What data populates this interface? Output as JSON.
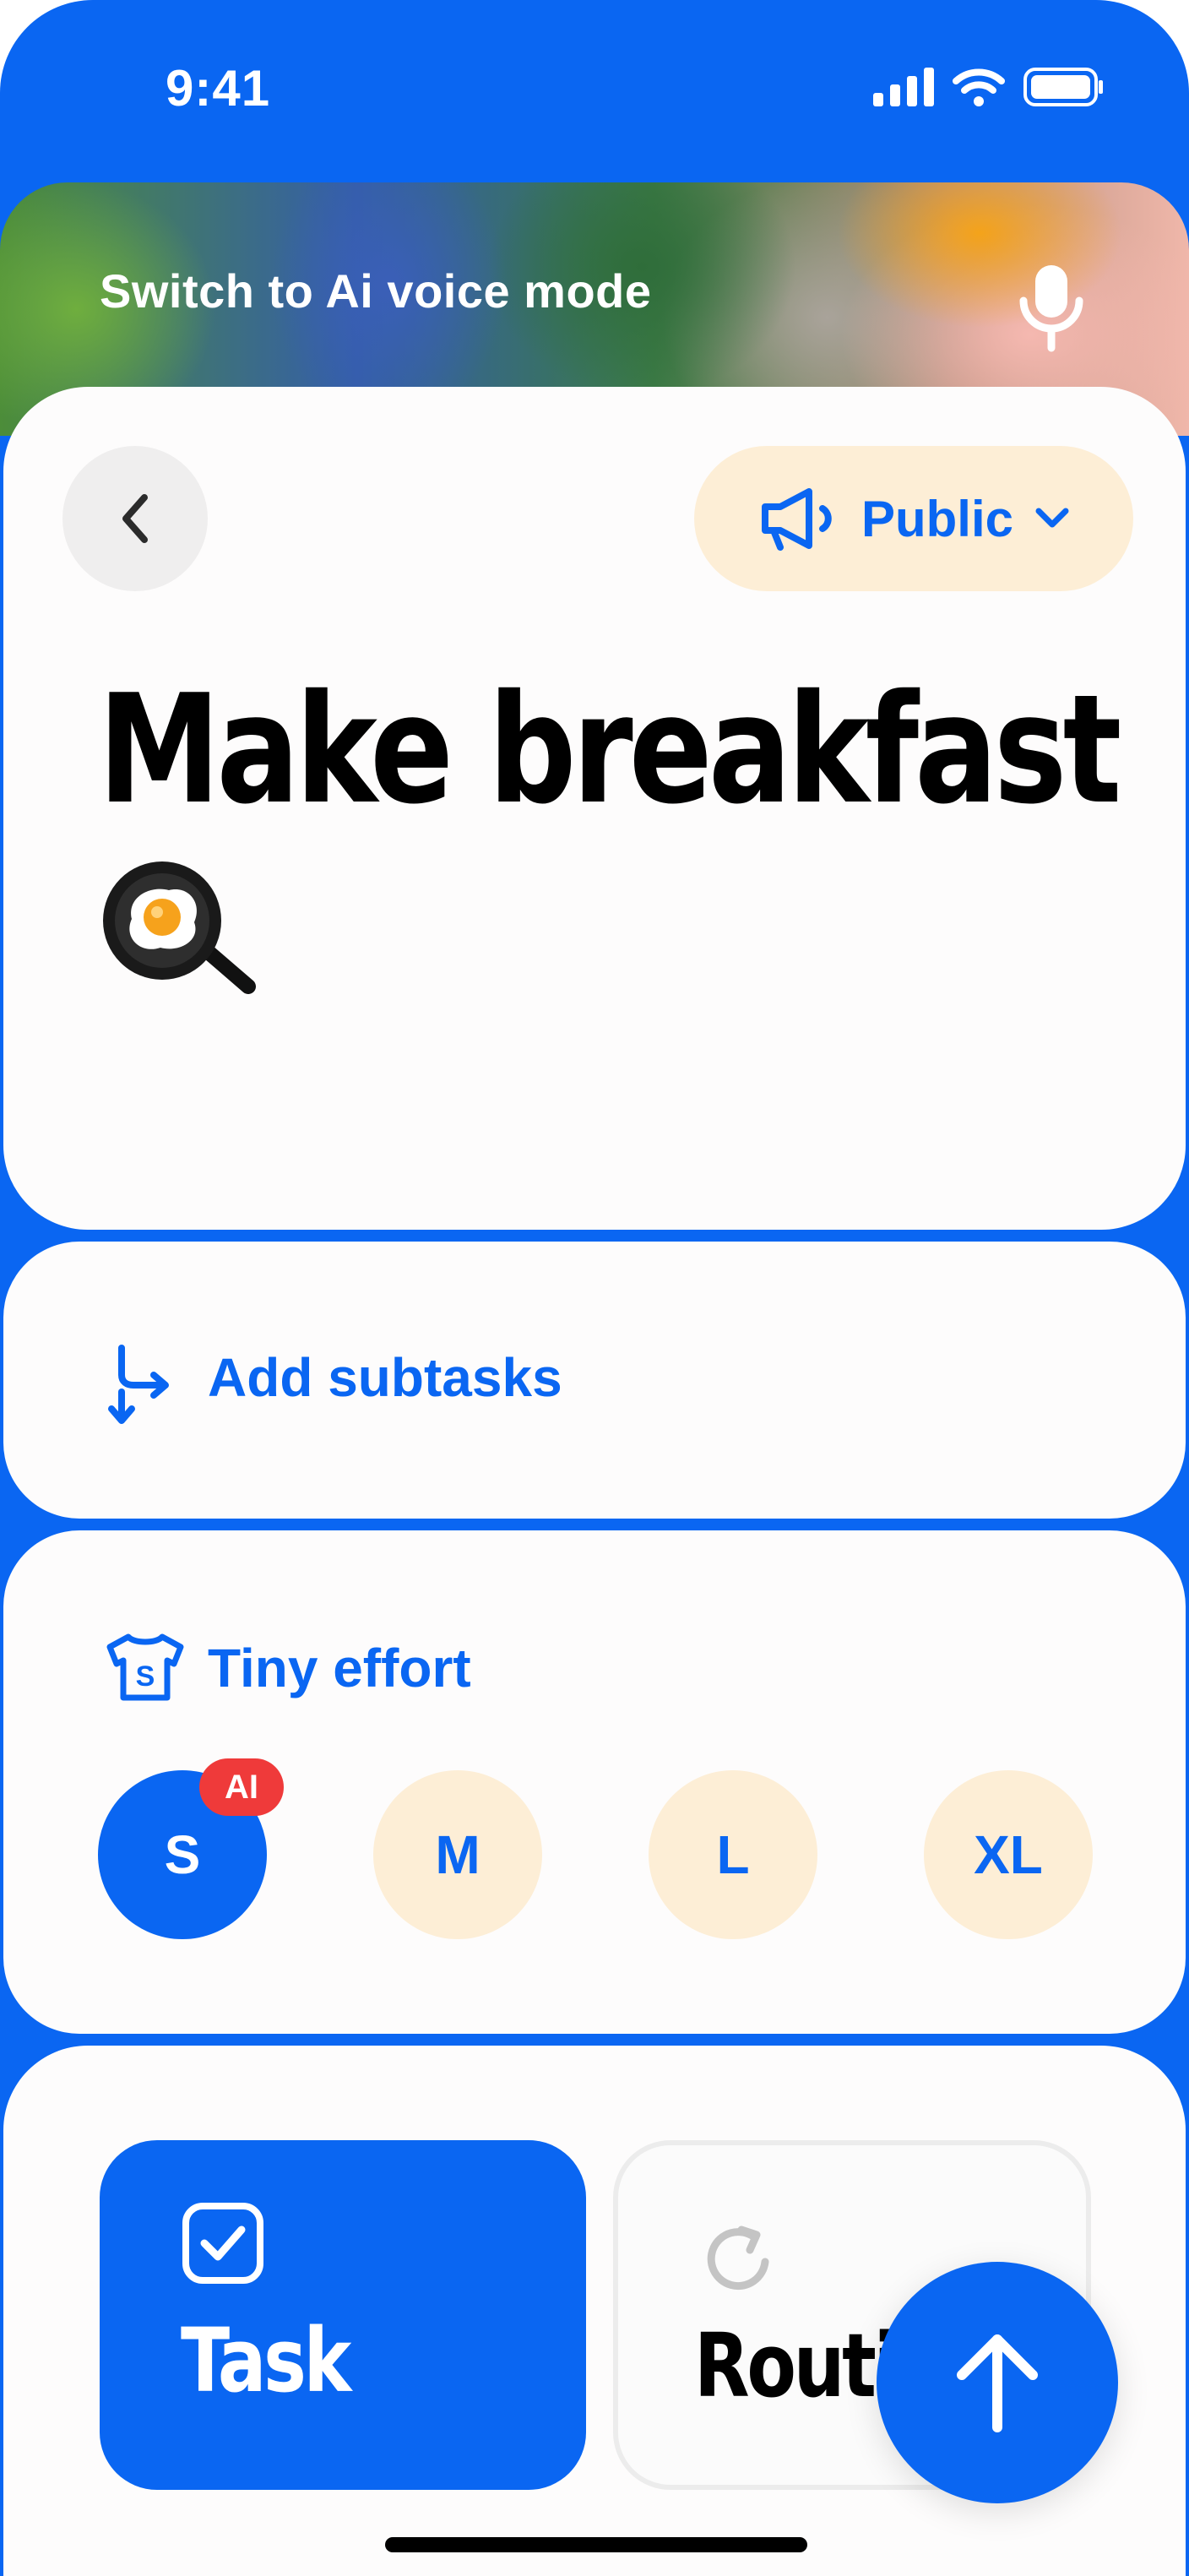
{
  "status_bar": {
    "time": "9:41"
  },
  "voice_banner": {
    "label": "Switch to Ai voice mode"
  },
  "header": {
    "visibility_label": "Public"
  },
  "task": {
    "title": "Make breakfast"
  },
  "subtasks": {
    "label": "Add subtasks"
  },
  "effort": {
    "label": "Tiny effort",
    "options": [
      {
        "label": "S",
        "selected": true,
        "badge": "AI"
      },
      {
        "label": "M",
        "selected": false
      },
      {
        "label": "L",
        "selected": false
      },
      {
        "label": "XL",
        "selected": false
      }
    ]
  },
  "type_selector": {
    "task_label": "Task",
    "routine_label": "Routine",
    "selected": "Task"
  },
  "colors": {
    "accent": "#0a66f2",
    "cream": "#fdeed6",
    "badge": "#ef3a3a"
  },
  "icons": {
    "back": "chevron-left-icon",
    "visibility": "megaphone-icon",
    "dropdown": "chevron-down-icon",
    "voice": "microphone-icon",
    "subtasks": "split-arrows-icon",
    "effort": "tshirt-icon",
    "task": "checkbox-icon",
    "routine": "repeat-icon",
    "submit": "arrow-up-icon"
  }
}
